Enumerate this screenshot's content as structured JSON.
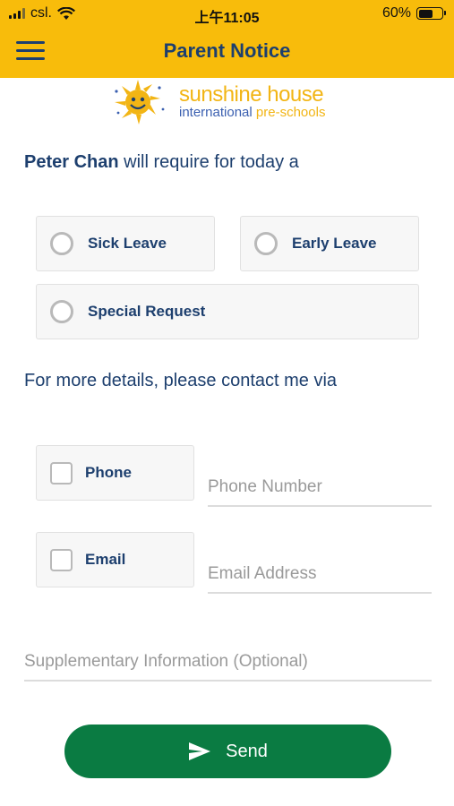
{
  "status_bar": {
    "carrier": "csl.",
    "time": "上午11:05",
    "battery_percent": "60%",
    "battery_level": 0.6
  },
  "app_bar": {
    "title": "Parent Notice",
    "menu_icon": "hamburger-menu-icon"
  },
  "logo": {
    "line1": "sunshine house",
    "line2_part1": "international ",
    "line2_part2": "pre-schools",
    "icon": "sun-face-icon"
  },
  "intro": {
    "name": "Peter Chan",
    "text": " will require for today a"
  },
  "request_options": [
    {
      "label": "Sick Leave",
      "selected": false
    },
    {
      "label": "Early Leave",
      "selected": false
    },
    {
      "label": "Special Request",
      "selected": false
    }
  ],
  "contact_prompt": "For more details, please contact me via",
  "contact_methods": [
    {
      "label": "Phone",
      "checked": false,
      "input_placeholder": "Phone Number",
      "input_value": ""
    },
    {
      "label": "Email",
      "checked": false,
      "input_placeholder": "Email Address",
      "input_value": ""
    }
  ],
  "supplementary": {
    "placeholder": "Supplementary Information (Optional)",
    "value": ""
  },
  "send_button": {
    "label": "Send",
    "icon": "send-paper-plane-icon"
  },
  "colors": {
    "header": "#f8bc0b",
    "primary_text": "#1d3f6e",
    "send_button": "#0a7b42",
    "option_bg": "#f7f7f7"
  }
}
